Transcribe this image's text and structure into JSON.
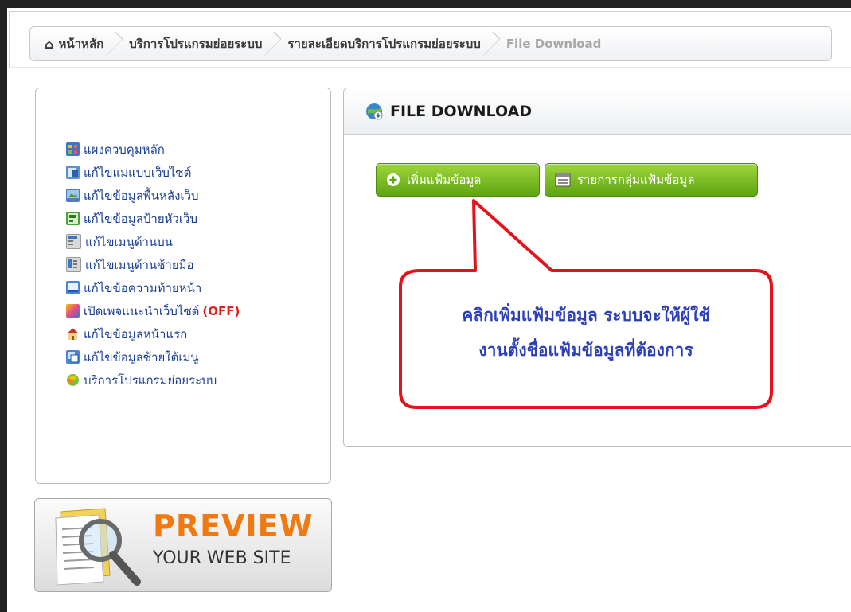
{
  "breadcrumb": {
    "items": [
      "หน้าหลัก",
      "บริการโปรแกรมย่อยระบบ",
      "รายละเอียดบริการโปรแกรมย่อยระบบ",
      "File Download"
    ]
  },
  "sidebar": {
    "items": [
      {
        "label": "แผงควบคุมหลัก",
        "icon": "dashboard-icon"
      },
      {
        "label": "แก้ไขแม่แบบเว็บไซต์",
        "icon": "template-icon"
      },
      {
        "label": "แก้ไขข้อมูลพื้นหลังเว็บ",
        "icon": "background-icon"
      },
      {
        "label": "แก้ไขข้อมูลป้ายหัวเว็บ",
        "icon": "banner-icon"
      },
      {
        "label": "แก้ไขเมนูด้านบน",
        "icon": "top-menu-icon"
      },
      {
        "label": "แก้ไขเมนูด้านซ้ายมือ",
        "icon": "left-menu-icon"
      },
      {
        "label": "แก้ไขข้อความท้ายหน้า",
        "icon": "footer-icon"
      },
      {
        "label": "เปิดเพจแนะนำเว็บไซต์",
        "icon": "recommend-icon",
        "badge": "(OFF)"
      },
      {
        "label": "แก้ไขข้อมูลหน้าแรก",
        "icon": "home-icon"
      },
      {
        "label": "แก้ไขข้อมูลซ้ายใต้เมนู",
        "icon": "left-under-menu-icon"
      },
      {
        "label": "บริการโปรแกรมย่อยระบบ",
        "icon": "services-icon"
      }
    ]
  },
  "preview": {
    "title": "PREVIEW",
    "subtitle": "YOUR WEB SITE"
  },
  "panel": {
    "title": "FILE DOWNLOAD"
  },
  "buttons": {
    "add_folder": "เพิ่มแฟ้มข้อมูล",
    "folder_list": "รายการกลุ่มแฟ้มข้อมูล"
  },
  "callout": {
    "line1": "คลิกเพิ่มแฟ้มข้อมูล ระบบจะให้ผู้ใช้",
    "line2": "งานตั้งชื่อแฟ้มข้อมูลที่ต้องการ"
  },
  "colors": {
    "button_green": "#6db51a",
    "link_blue": "#1b3f91",
    "callout_red": "#e8101a",
    "callout_text": "#2c3fb8",
    "off_red": "#e02020",
    "preview_orange": "#f07a10"
  }
}
